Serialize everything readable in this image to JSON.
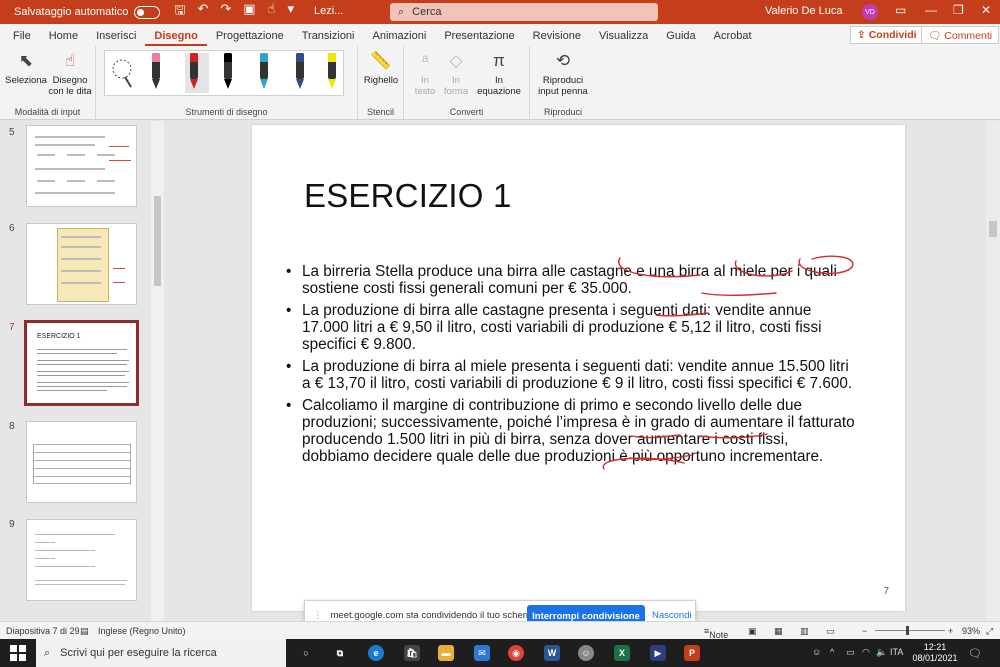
{
  "titlebar": {
    "autosave_label": "Salvataggio automatico",
    "document_name": "Lezi...",
    "search_placeholder": "Cerca",
    "user_name": "Valerio De Luca",
    "user_initials": "VD"
  },
  "menu": {
    "tabs": [
      "File",
      "Home",
      "Inserisci",
      "Disegno",
      "Progettazione",
      "Transizioni",
      "Animazioni",
      "Presentazione",
      "Revisione",
      "Visualizza",
      "Guida",
      "Acrobat"
    ],
    "active_tab": "Disegno",
    "share_label": "Condividi",
    "comments_label": "Commenti"
  },
  "ribbon": {
    "seleziona": "Seleziona",
    "disegno_dita": "Disegno con le dita",
    "group_input": "Modalità di input",
    "group_pens": "Strumenti di disegno",
    "righello": "Righello",
    "group_stencil": "Stencil",
    "in_testo": "In testo",
    "in_forma": "In forma",
    "in_equazione": "In equazione",
    "group_converti": "Converti",
    "riproduci": "Riproduci input penna",
    "group_riproduci": "Riproduci",
    "pen_colors": [
      "#e87ea1",
      "#d32020",
      "#000000",
      "#2fa6c9",
      "#2e4e8a",
      "#f3e600"
    ]
  },
  "thumbnails": [
    {
      "num": "5",
      "active": false
    },
    {
      "num": "6",
      "active": false
    },
    {
      "num": "7",
      "active": true,
      "title": "ESERCIZIO 1"
    },
    {
      "num": "8",
      "active": false
    },
    {
      "num": "9",
      "active": false
    }
  ],
  "slide": {
    "title": "ESERCIZIO 1",
    "bullets": [
      "La birreria Stella produce una birra alle castagne e una birra al miele per i quali sostiene costi fissi generali comuni per € 35.000.",
      "La produzione di birra alle castagne presenta i seguenti dati: vendite annue 17.000 litri a € 9,50 il litro, costi variabili di produzione € 5,12 il litro, costi fissi specifici € 9.800.",
      "La produzione di birra al miele presenta i seguenti dati: vendite annue 15.500 litri a € 13,70 il litro, costi variabili di produzione € 9 il litro, costi fissi specifici € 7.600.",
      "Calcoliamo il margine di contribuzione di primo e secondo livello delle due produzioni; successivamente, poiché l’impresa è in grado di aumentare il fatturato producendo 1.500 litri in più di birra, senza dover aumentare i costi fissi, dobbiamo decidere quale delle due produzioni è più opportuno incrementare."
    ],
    "page_number": "7",
    "ink_color": "#d42b2b"
  },
  "sharebar": {
    "message": "meet.google.com sta condividendo il tuo schermo.",
    "stop_label": "Interrompi condivisione",
    "hide_label": "Nascondi"
  },
  "status": {
    "slide_info": "Diapositiva 7 di 29",
    "language": "Inglese (Regno Unito)",
    "notes": "Note",
    "zoom": "93%",
    "zoom_level": 0.45
  },
  "taskbar": {
    "search_placeholder": "Scrivi qui per eseguire la ricerca",
    "language": "ITA",
    "time": "12:21",
    "date": "08/01/2021"
  }
}
